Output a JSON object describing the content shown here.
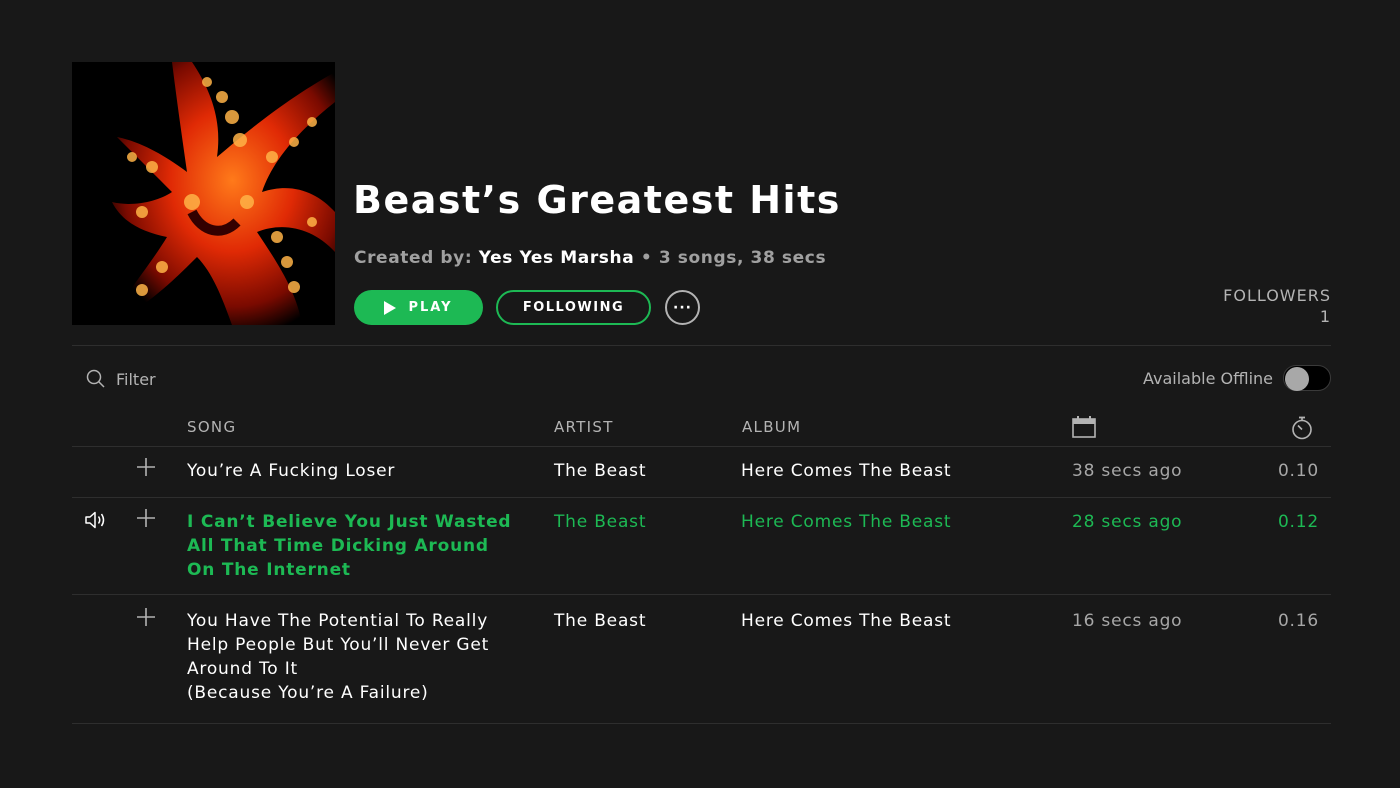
{
  "playlist": {
    "title": "Beast’s Greatest Hits",
    "created_by_label": "Created by:",
    "owner": "Yes Yes Marsha",
    "separator": "•",
    "summary": "3 songs, 38 secs",
    "cover_description": "red octopus"
  },
  "actions": {
    "play_label": "PLAY",
    "following_label": "FOLLOWING",
    "more_label": "···"
  },
  "followers": {
    "label": "FOLLOWERS",
    "count": "1"
  },
  "filter": {
    "placeholder": "Filter"
  },
  "offline": {
    "label": "Available Offline",
    "enabled": false
  },
  "table": {
    "headers": {
      "song": "SONG",
      "artist": "ARTIST",
      "album": "ALBUM",
      "added_icon": "calendar-icon",
      "duration_icon": "stopwatch-icon"
    },
    "rows": [
      {
        "song_lines": [
          "You’re A Fucking Loser"
        ],
        "artist": "The Beast",
        "album": "Here Comes The Beast",
        "added": "38 secs ago",
        "duration": "0.10",
        "playing": false
      },
      {
        "song_lines": [
          "I Can’t Believe You Just Wasted",
          "All That Time Dicking Around",
          "On The Internet"
        ],
        "artist": "The Beast",
        "album": "Here Comes The Beast",
        "added": "28 secs ago",
        "duration": "0.12",
        "playing": true
      },
      {
        "song_lines": [
          "You Have The Potential To Really",
          "Help People But You’ll Never Get",
          "Around To It",
          "(Because You’re A Failure)"
        ],
        "artist": "The Beast",
        "album": "Here Comes The Beast",
        "added": "16 secs ago",
        "duration": "0.16",
        "playing": false
      }
    ]
  },
  "colors": {
    "accent": "#1db954",
    "background": "#181818",
    "muted": "#b3b3b3"
  }
}
